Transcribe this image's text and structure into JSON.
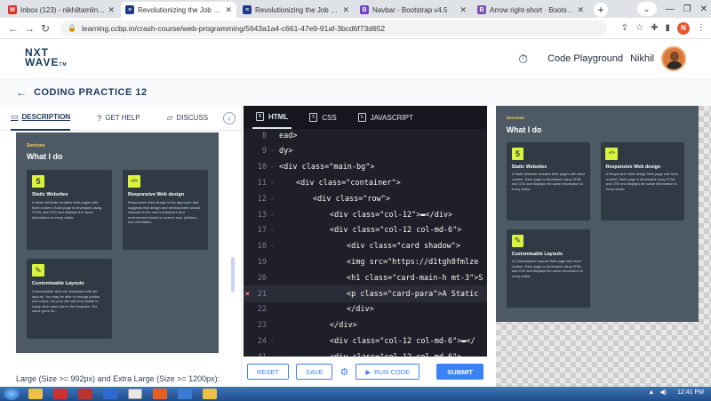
{
  "browser": {
    "tabs": [
      {
        "title": "Inbox (123) - nikhiltamlindia@",
        "favicon": "gmail-icon",
        "color": "#d93025",
        "glyph": "M",
        "active": false
      },
      {
        "title": "Revolutionizing the Job Marke",
        "favicon": "ccbp-icon",
        "color": "#1e3a8a",
        "glyph": "≡",
        "active": true
      },
      {
        "title": "Revolutionizing the Job Marke",
        "favicon": "ccbp-icon",
        "color": "#1e3a8a",
        "glyph": "≡",
        "active": false
      },
      {
        "title": "Navbar · Bootstrap v4.5",
        "favicon": "bootstrap-icon",
        "color": "#6f42c1",
        "glyph": "B",
        "active": false
      },
      {
        "title": "Arrow right-short · Bootstrap",
        "favicon": "bootstrap-icon",
        "color": "#7952b3",
        "glyph": "B",
        "active": false
      }
    ],
    "new_tab": "+",
    "url": "learning.ccbp.in/crash-course/web-programming/5643a1a4-c661-47e9-91af-3bcd6f73d652",
    "profile_initial": "N"
  },
  "app": {
    "logo_line1": "NXT",
    "logo_line2": "WAVE",
    "logo_tm": "TM",
    "code_playground": "Code Playground",
    "user_name": "Nikhil",
    "practice_title": "CODING PRACTICE 12"
  },
  "left_panel": {
    "tabs": [
      {
        "label": "DESCRIPTION",
        "icon": "description-icon",
        "glyph": "▭",
        "active": true
      },
      {
        "label": "GET HELP",
        "icon": "help-icon",
        "glyph": "?",
        "active": false
      },
      {
        "label": "DISCUSS",
        "icon": "discuss-icon",
        "glyph": "▱",
        "active": false
      }
    ],
    "collapse": "‹",
    "footer_text": "Large (Size >= 992px) and Extra Large (Size >= 1200px):"
  },
  "preview": {
    "services": "Services",
    "heading": "What I do",
    "cards": [
      {
        "title": "Static Websites",
        "icon": "html5-icon",
        "glyph": "5",
        "para": "A Static Website contains Web pages with fixed content. Each page is developed using HTML and CSS and displays the same information to every visitor."
      },
      {
        "title": "Responsive Web design",
        "icon": "code-window-icon",
        "glyph": "</>",
        "para": "A Responsive Web design Web page with fixed content. Each page is developed using HTML and CSS and displays the same information to every visitor."
      },
      {
        "title": "Customisable Layouts",
        "icon": "pencil-icon",
        "glyph": "✎",
        "para": "A Customisable Layouts Web page with fixed content. Each page is developed using HTML and CSS and displays the same information to every visitor."
      }
    ],
    "left_cards": [
      {
        "title": "Static Websites",
        "glyph": "5",
        "para": "A Static Website contains Web pages with fixed content. Each page is developed using HTML and CSS and displays the same information to every visitor."
      },
      {
        "title": "Responsive Web design",
        "glyph": "</>",
        "para": "Responsive Web design is the approach that suggests that design and development should respond to the user's behaviour and environment based on screen size, platform and orientation."
      },
      {
        "title": "Customisable Layouts",
        "glyph": "✎",
        "para": "Customisable sites are templates with set layouts. You may be able to change photos and colors, but your site will look similar to many other sites due to the template. The same goes for..."
      }
    ]
  },
  "editor": {
    "tabs": [
      {
        "label": "HTML",
        "icon": "html-file-icon",
        "active": true
      },
      {
        "label": "CSS",
        "icon": "css-file-icon",
        "active": false
      },
      {
        "label": "JAVASCRIPT",
        "icon": "js-file-icon",
        "active": false
      }
    ],
    "lines": [
      {
        "num": "8",
        "fold": "",
        "text": "ead>",
        "indent": 0
      },
      {
        "num": "9",
        "fold": "-",
        "text": "dy>",
        "indent": 0
      },
      {
        "num": "10",
        "fold": "-",
        "text": "<div class=\"main-bg\">",
        "indent": 0
      },
      {
        "num": "11",
        "fold": "-",
        "text": "<div class=\"container\">",
        "indent": 1
      },
      {
        "num": "12",
        "fold": "-",
        "text": "<div class=\"row\">",
        "indent": 2
      },
      {
        "num": "13",
        "fold": "-",
        "text": "<div class=\"col-12\">▬</div>",
        "indent": 3
      },
      {
        "num": "17",
        "fold": "-",
        "text": "<div class=\"col-12 col-md-6\">",
        "indent": 3
      },
      {
        "num": "18",
        "fold": "-",
        "text": "<div class=\"card shadow\">",
        "indent": 4
      },
      {
        "num": "19",
        "fold": "",
        "text": "<img src=\"https://d1tgh8fmlze",
        "indent": 4
      },
      {
        "num": "20",
        "fold": "",
        "text": "<h1 class=\"card-main-h mt-3\">S",
        "indent": 4
      },
      {
        "num": "21",
        "fold": "",
        "text": "<p class=\"card-para\">A Static",
        "indent": 4,
        "error": true
      },
      {
        "num": "22",
        "fold": "",
        "text": "</div>",
        "indent": 4
      },
      {
        "num": "23",
        "fold": "",
        "text": "</div>",
        "indent": 3
      },
      {
        "num": "24",
        "fold": "-",
        "text": "<div class=\"col-12 col-md-6\">▬</",
        "indent": 3
      },
      {
        "num": "31",
        "fold": "-",
        "text": "<div class=\"col-12 col-md-6\">",
        "indent": 3
      },
      {
        "num": "32",
        "fold": "-",
        "text": "<div class=\"card shadow\">",
        "indent": 4
      }
    ],
    "reset": "RESET",
    "save": "SAVE",
    "run_code": "RUN CODE",
    "submit": "SUBMIT"
  },
  "taskbar": {
    "time": "12:41 PM"
  },
  "colors": {
    "accent": "#3b82f6",
    "brand_navy": "#1e3a5f",
    "preview_bg": "#4d5a66",
    "card_bg": "#2f3a44",
    "highlight": "#d9f43b"
  }
}
